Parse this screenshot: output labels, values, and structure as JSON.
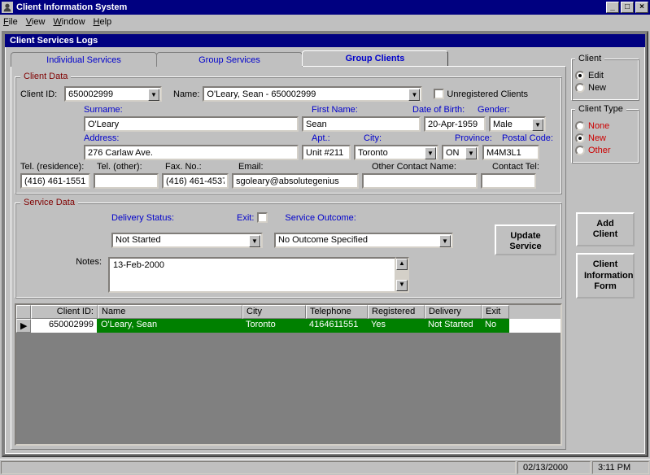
{
  "window": {
    "title": "Client Information System"
  },
  "menu": {
    "file": "File",
    "view": "View",
    "window": "Window",
    "help": "Help"
  },
  "child_title": "Client Services Logs",
  "tabs": {
    "t1": "Individual Services",
    "t2": "Group Services",
    "t3": "Group Clients"
  },
  "client_data": {
    "legend": "Client Data",
    "client_id_label": "Client ID:",
    "client_id": "650002999",
    "name_label": "Name:",
    "name": "O'Leary, Sean    -    650002999",
    "unregistered_label": "Unregistered Clients",
    "surname_label": "Surname:",
    "surname": "O'Leary",
    "firstname_label": "First Name:",
    "firstname": "Sean",
    "dob_label": "Date of Birth:",
    "dob": "20-Apr-1959",
    "gender_label": "Gender:",
    "gender": "Male",
    "address_label": "Address:",
    "address": "276 Carlaw Ave.",
    "apt_label": "Apt.:",
    "apt": "Unit #211",
    "city_label": "City:",
    "city": "Toronto",
    "province_label": "Province:",
    "province": "ON",
    "postal_label": "Postal Code:",
    "postal": "M4M3L1",
    "tel_res_label": "Tel. (residence):",
    "tel_res": "(416) 461-1551",
    "tel_other_label": "Tel. (other):",
    "tel_other": "",
    "fax_label": "Fax. No.:",
    "fax": "(416) 461-4537",
    "email_label": "Email:",
    "email": "sgoleary@absolutegenius",
    "other_contact_label": "Other Contact Name:",
    "other_contact": "",
    "contact_tel_label": "Contact Tel:",
    "contact_tel": ""
  },
  "service_data": {
    "legend": "Service Data",
    "delivery_label": "Delivery Status:",
    "delivery": "Not Started",
    "exit_label": "Exit:",
    "outcome_label": "Service Outcome:",
    "outcome": "No Outcome Specified",
    "notes_label": "Notes:",
    "notes": "13-Feb-2000",
    "update_btn": "Update Service"
  },
  "grid": {
    "headers": {
      "client_id": "Client ID:",
      "name": "Name",
      "city": "City",
      "telephone": "Telephone",
      "registered": "Registered",
      "delivery": "Delivery",
      "exit": "Exit"
    },
    "rows": [
      {
        "client_id": "650002999",
        "name": "O'Leary, Sean",
        "city": "Toronto",
        "telephone": "4164611551",
        "registered": "Yes",
        "delivery": "Not Started",
        "exit": "No"
      }
    ]
  },
  "side": {
    "client_legend": "Client",
    "edit": "Edit",
    "new": "New",
    "type_legend": "Client Type",
    "none": "None",
    "type_new": "New",
    "other": "Other",
    "add_btn": "Add Client",
    "info_btn": "Client Information Form"
  },
  "status": {
    "date": "02/13/2000",
    "time": "3:11 PM"
  }
}
